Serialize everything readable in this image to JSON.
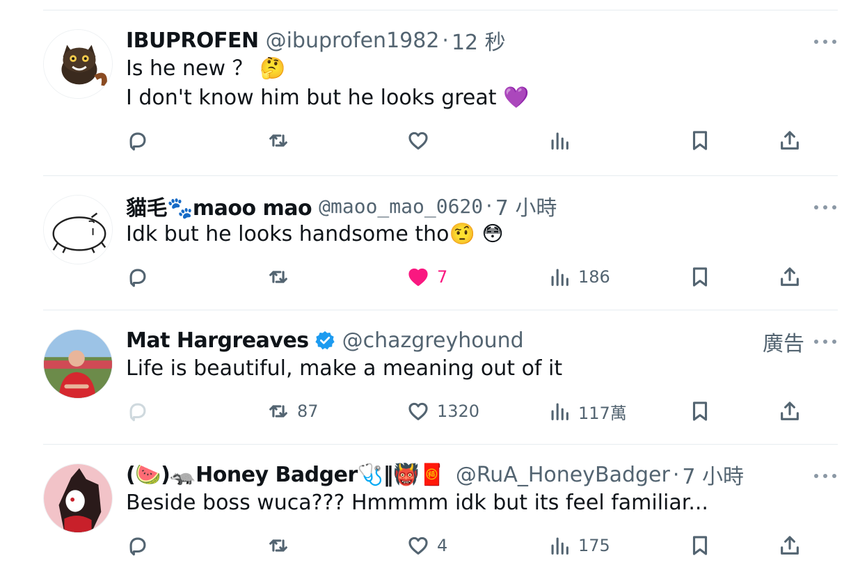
{
  "tweets": [
    {
      "name": "IBUPROFEN",
      "handle": "@ibuprofen1982",
      "dot": "·",
      "time": "12 秒",
      "lines": [
        "Is he new ？ 🤔",
        "I don't know him but he looks great 💜"
      ],
      "reply_count": "",
      "retweet_count": "",
      "like_count": "",
      "views_count": ""
    },
    {
      "name": "貓毛🐾maoo mao",
      "handle": "@maoo_mao_0620",
      "dot": "·",
      "time": "7 小時",
      "lines": [
        "Idk but he looks handsome tho🤨 😳"
      ],
      "reply_count": "",
      "retweet_count": "",
      "like_count": "7",
      "views_count": "186"
    },
    {
      "name": "Mat Hargreaves",
      "handle": "@chazgreyhound",
      "ad_label": "廣告",
      "lines": [
        "Life is beautiful, make a meaning out of it"
      ],
      "reply_count": "",
      "retweet_count": "87",
      "like_count": "1320",
      "views_count": "117萬"
    },
    {
      "name": "(🍉)🦡Honey Badger🩺‖👹🧧",
      "handle": "@RuA_HoneyBadger",
      "dot": "·",
      "time": "7 小時",
      "lines": [
        "Beside boss wuca??? Hmmmm idk but its feel familiar..."
      ],
      "reply_count": "",
      "retweet_count": "",
      "like_count": "4",
      "views_count": "175"
    }
  ],
  "colors": {
    "text": "#0f1419",
    "muted": "#536471",
    "like_pink": "#f91880",
    "verified_blue": "#1d9bf0",
    "divider": "#e6ecf0"
  },
  "icons": [
    "reply-icon",
    "retweet-icon",
    "like-icon",
    "views-icon",
    "bookmark-icon",
    "share-icon",
    "more-icon",
    "verified-badge-icon"
  ]
}
